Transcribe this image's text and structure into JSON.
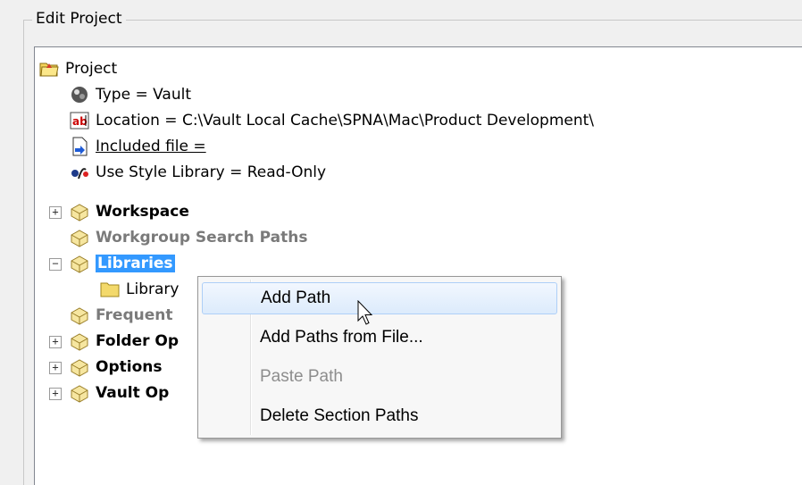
{
  "group": {
    "title": "Edit Project"
  },
  "tree": {
    "root": {
      "label": "Project",
      "icon": "project-folder-icon"
    },
    "properties": [
      {
        "label": "Type = Vault",
        "icon": "vault-type-icon"
      },
      {
        "label": "Location = C:\\Vault Local Cache\\SPNA\\Mac\\Product Development\\",
        "icon": "text-ab-icon"
      },
      {
        "label": "Included file = ",
        "icon": "included-file-icon"
      },
      {
        "label": "Use Style Library = Read-Only",
        "icon": "style-library-icon"
      }
    ],
    "sections": [
      {
        "label": "Workspace",
        "expander": "+"
      },
      {
        "label": "Workgroup Search Paths"
      },
      {
        "label": "Libraries",
        "expander": "−"
      },
      {
        "label": "Library"
      },
      {
        "label": "Frequent"
      },
      {
        "label": "Folder Op",
        "expander": "+"
      },
      {
        "label": "Options",
        "expander": "+"
      },
      {
        "label": "Vault Op",
        "expander": "+"
      }
    ]
  },
  "context_menu": {
    "items": [
      {
        "label": "Add Path",
        "state": "hover"
      },
      {
        "label": "Add Paths from File...",
        "state": "enabled"
      },
      {
        "label": "Paste Path",
        "state": "disabled"
      },
      {
        "label": "Delete Section Paths",
        "state": "enabled"
      }
    ]
  }
}
